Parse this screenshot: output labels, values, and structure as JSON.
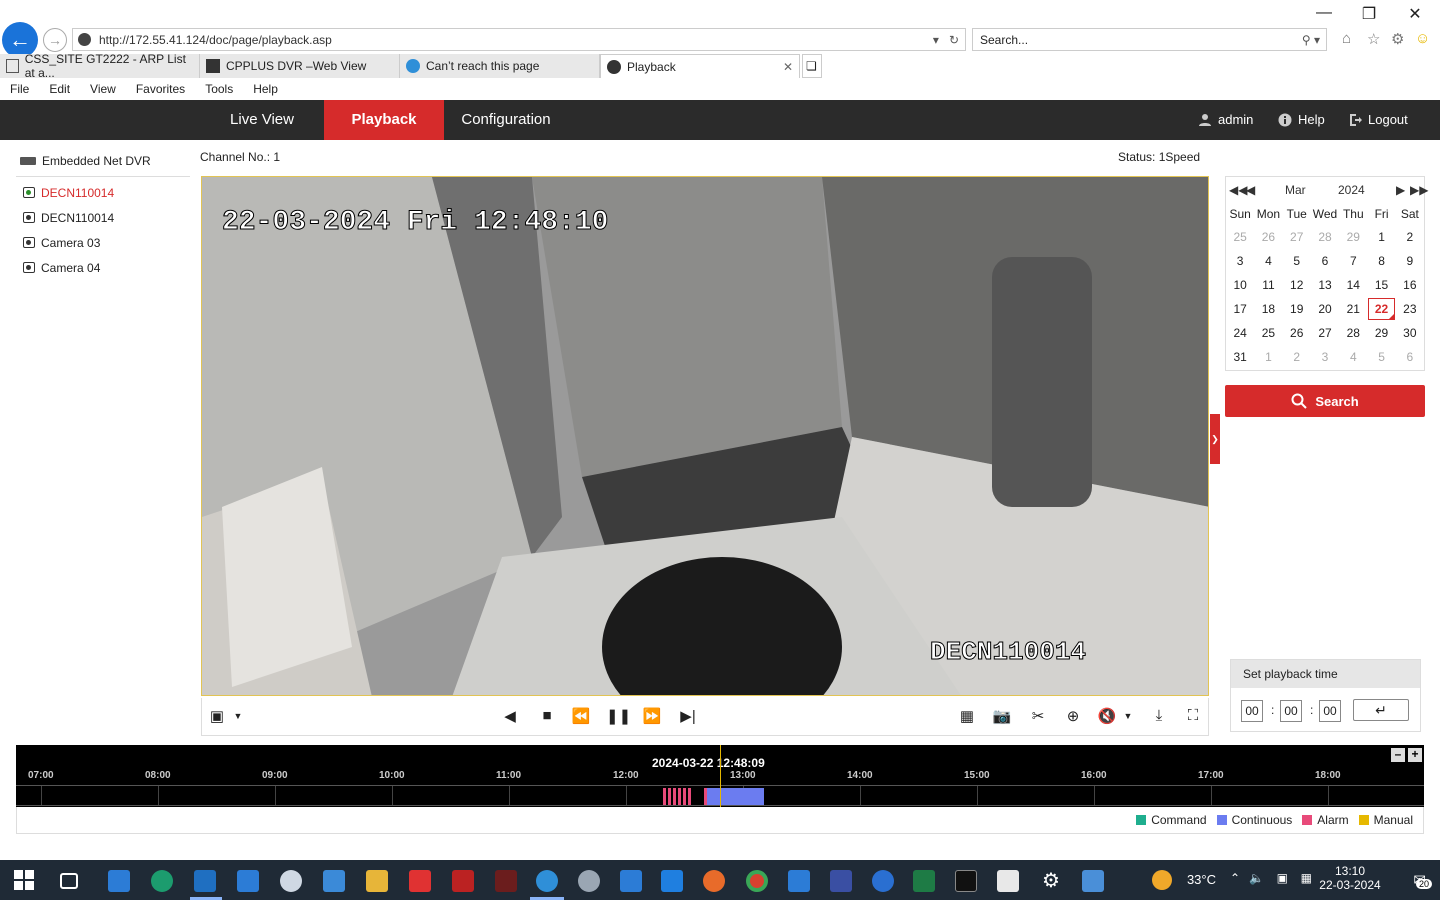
{
  "browser": {
    "url": "http://172.55.41.124/doc/page/playback.asp",
    "search_placeholder": "Search...",
    "tabs": [
      {
        "label": "CSS_SITE GT2222 - ARP List at a..."
      },
      {
        "label": "CPPLUS DVR –Web View"
      },
      {
        "label": "Can’t reach this page"
      },
      {
        "label": "Playback"
      }
    ],
    "menu": [
      "File",
      "Edit",
      "View",
      "Favorites",
      "Tools",
      "Help"
    ]
  },
  "app": {
    "nav": {
      "live_view": "Live View",
      "playback": "Playback",
      "configuration": "Configuration"
    },
    "user": "admin",
    "help": "Help",
    "logout": "Logout",
    "accent_color": "#d62b2b"
  },
  "sidebar": {
    "device": "Embedded Net DVR",
    "cameras": [
      {
        "label": "DECN110014",
        "selected": true
      },
      {
        "label": "DECN110014",
        "selected": false
      },
      {
        "label": "Camera 03",
        "selected": false
      },
      {
        "label": "Camera 04",
        "selected": false
      }
    ]
  },
  "player": {
    "channel": "Channel No.: 1",
    "status": "Status: 1Speed",
    "osd_datetime": "22-03-2024 Fri 12:48:10",
    "osd_name": "DECN110014"
  },
  "calendar": {
    "month": "Mar",
    "year": "2024",
    "weekdays": [
      "Sun",
      "Mon",
      "Tue",
      "Wed",
      "Thu",
      "Fri",
      "Sat"
    ],
    "days": [
      "25",
      "26",
      "27",
      "28",
      "29",
      "1",
      "2",
      "3",
      "4",
      "5",
      "6",
      "7",
      "8",
      "9",
      "10",
      "11",
      "12",
      "13",
      "14",
      "15",
      "16",
      "17",
      "18",
      "19",
      "20",
      "21",
      "22",
      "23",
      "24",
      "25",
      "26",
      "27",
      "28",
      "29",
      "30",
      "31",
      "1",
      "2",
      "3",
      "4",
      "5",
      "6"
    ],
    "selected_day": "22",
    "search_label": "Search"
  },
  "set_playback": {
    "title": "Set playback time",
    "hh": "00",
    "mm": "00",
    "ss": "00"
  },
  "timeline": {
    "current": "2024-03-22 12:48:09",
    "ticks": [
      "07:00",
      "08:00",
      "09:00",
      "10:00",
      "11:00",
      "12:00",
      "13:00",
      "14:00",
      "15:00",
      "16:00",
      "17:00",
      "18:00"
    ],
    "legend": [
      {
        "label": "Command",
        "color": "#1fae8e"
      },
      {
        "label": "Continuous",
        "color": "#6b7cf0"
      },
      {
        "label": "Alarm",
        "color": "#e84a7a"
      },
      {
        "label": "Manual",
        "color": "#e6b800"
      }
    ]
  },
  "taskbar": {
    "temperature": "33°C",
    "time": "13:10",
    "date": "22-03-2024",
    "notifications": "20"
  }
}
